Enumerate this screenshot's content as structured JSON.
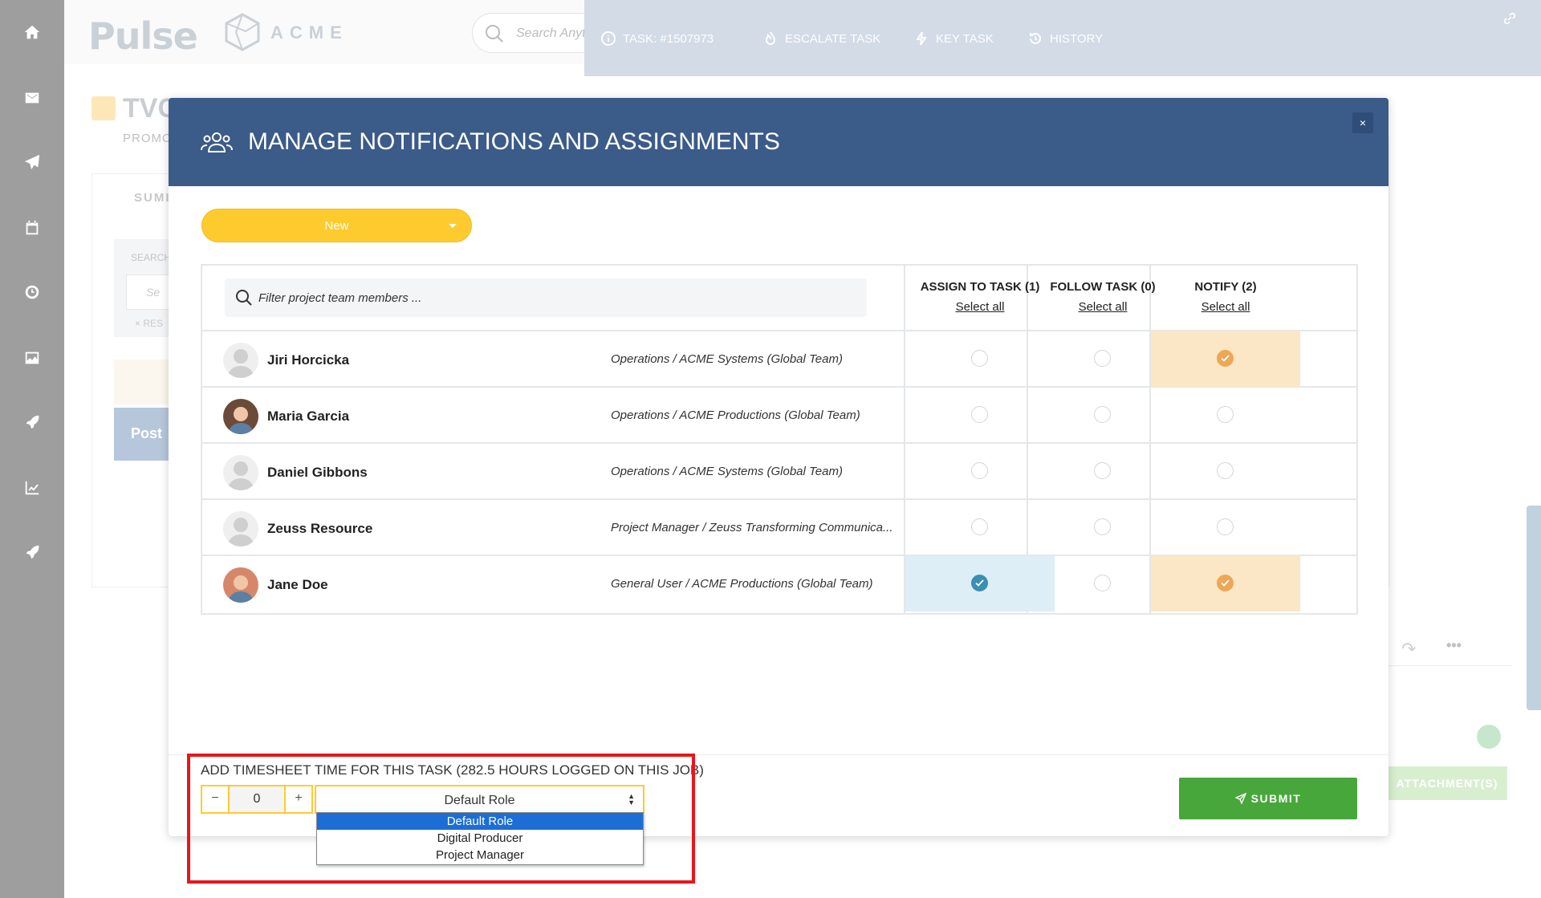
{
  "app": {
    "logo": "Pulse",
    "brand": "ACME",
    "search_placeholder": "Search Anything",
    "project_title": "TVC",
    "project_sub": "PROMO",
    "summary_tab": "SUMI",
    "search_label": "SEARCH",
    "search_box": "Se",
    "reset": "RES",
    "post_label": "Post"
  },
  "task_toolbar": {
    "task_id": "TASK: #1507973",
    "escalate": "ESCALATE TASK",
    "key_task": "KEY TASK",
    "history": "HISTORY"
  },
  "modal": {
    "title": "MANAGE NOTIFICATIONS AND ASSIGNMENTS",
    "close": "×",
    "status": "New",
    "filter_placeholder": "Filter project team members ...",
    "columns": [
      {
        "title": "ASSIGN TO TASK (1)",
        "select_all": "Select all"
      },
      {
        "title": "FOLLOW TASK (0)",
        "select_all": "Select all"
      },
      {
        "title": "NOTIFY (2)",
        "select_all": "Select all"
      }
    ],
    "members": [
      {
        "name": "Jiri Horcicka",
        "role": "Operations / ACME Systems (Global Team)",
        "assign": false,
        "follow": false,
        "notify": true
      },
      {
        "name": "Maria Garcia",
        "role": "Operations / ACME Productions (Global Team)",
        "assign": false,
        "follow": false,
        "notify": false
      },
      {
        "name": "Daniel Gibbons",
        "role": "Operations / ACME Systems (Global Team)",
        "assign": false,
        "follow": false,
        "notify": false
      },
      {
        "name": "Zeuss Resource",
        "role": "Project Manager / Zeuss Transforming Communica...",
        "assign": false,
        "follow": false,
        "notify": false
      },
      {
        "name": "Jane Doe",
        "role": "General User / ACME Productions (Global Team)",
        "assign": true,
        "follow": false,
        "notify": true
      }
    ],
    "timesheet": {
      "label": "ADD TIMESHEET TIME FOR THIS TASK (282.5 HOURS LOGGED ON THIS JOB)",
      "minus": "−",
      "value": "0",
      "plus": "+",
      "role_selected": "Default Role",
      "role_options": [
        "Default Role",
        "Digital Producer",
        "Project Manager"
      ]
    },
    "submit": "SUBMIT"
  },
  "background": {
    "attachments": "ATTACHMENT(S)"
  },
  "colors": {
    "header": "#3b5b89",
    "status": "#fecb2f",
    "assign_on": "#3a8fb3",
    "notify_on": "#eca856",
    "submit": "#47a73a",
    "highlight": "#e8161b"
  }
}
